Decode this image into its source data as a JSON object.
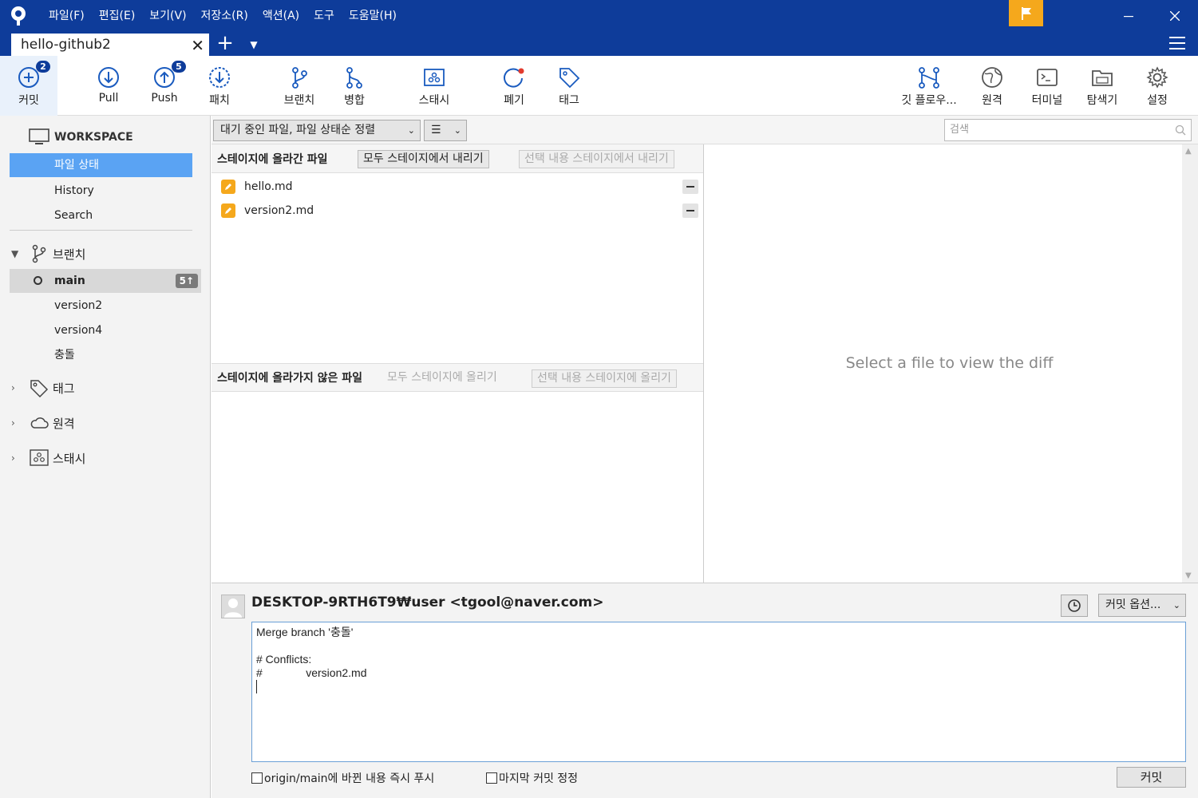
{
  "titlebar": {
    "menu": [
      "파일(F)",
      "편집(E)",
      "보기(V)",
      "저장소(R)",
      "액션(A)",
      "도구",
      "도움말(H)"
    ]
  },
  "tabs": {
    "repo_tab": "hello-github2"
  },
  "toolbar": {
    "commit": {
      "label": "커밋",
      "badge": "2"
    },
    "pull": {
      "label": "Pull"
    },
    "push": {
      "label": "Push",
      "badge": "5"
    },
    "fetch": {
      "label": "패치"
    },
    "branch": {
      "label": "브랜치"
    },
    "merge": {
      "label": "병합"
    },
    "stash": {
      "label": "스태시"
    },
    "discard": {
      "label": "폐기"
    },
    "tag": {
      "label": "태그"
    },
    "gitflow": {
      "label": "깃 플로우..."
    },
    "remote": {
      "label": "원격"
    },
    "terminal": {
      "label": "터미널"
    },
    "explorer": {
      "label": "탐색기"
    },
    "settings": {
      "label": "설정"
    }
  },
  "sidebar": {
    "workspace_label": "WORKSPACE",
    "workspace_items": [
      "파일 상태",
      "History",
      "Search"
    ],
    "branches_label": "브랜치",
    "current_branch": "main",
    "current_branch_ahead": "5↑",
    "branches": [
      "version2",
      "version4",
      "충돌"
    ],
    "tags_label": "태그",
    "remotes_label": "원격",
    "stashes_label": "스태시"
  },
  "filter": {
    "sort_value": "대기 중인 파일, 파일 상태순 정렬",
    "view_icon": "☰",
    "search_placeholder": "검색"
  },
  "staged": {
    "title": "스테이지에 올라간 파일",
    "unstage_all": "모두 스테이지에서 내리기",
    "unstage_selected": "선택 내용 스테이지에서 내리기",
    "files": [
      "hello.md",
      "version2.md"
    ]
  },
  "unstaged": {
    "title": "스테이지에 올라가지 않은 파일",
    "stage_all": "모두 스테이지에 올리기",
    "stage_selected": "선택 내용 스테이지에 올리기"
  },
  "diff": {
    "placeholder": "Select a file to view the diff"
  },
  "commit": {
    "author": "DESKTOP-9RTH6T9₩user <tgool@naver.com>",
    "options_label": "커밋 옵션...",
    "message_lines": [
      "Merge branch '충돌'",
      "",
      "# Conflicts:",
      "#\t\tversion2.md"
    ],
    "push_immediately": "origin/main에 바뀐 내용 즉시 푸시",
    "amend": "마지막 커밋 정정",
    "commit_button": "커밋"
  },
  "colors": {
    "titlebar": "#0e3c9a",
    "flag": "#f5a81c",
    "selection": "#5aa3f3",
    "modified": "#f5a81c"
  }
}
